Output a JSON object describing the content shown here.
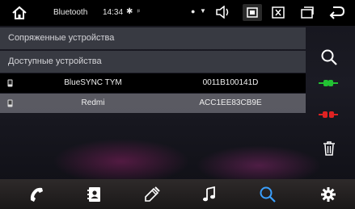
{
  "statusbar": {
    "title": "Bluetooth",
    "time": "14:34"
  },
  "sections": {
    "paired": "Сопряженные устройства",
    "available": "Доступные устройства"
  },
  "devices": [
    {
      "name": "BlueSYNC TYM",
      "address": "0011B100141D",
      "selected": false
    },
    {
      "name": "Redmi",
      "address": "ACC1EE83CB9E",
      "selected": true
    }
  ],
  "colors": {
    "connect": "#22c233",
    "disconnect": "#e02222",
    "search_active": "#3aa0ff",
    "selected_row": "#5f6068"
  },
  "icons": {
    "home": "home-icon",
    "volume": "volume-icon",
    "screenshot": "screenshot-icon",
    "close": "close-icon",
    "window": "window-icon",
    "back": "back-icon",
    "search": "search-icon",
    "connect": "connect-icon",
    "disconnect": "disconnect-icon",
    "delete": "trash-icon",
    "phone": "phone-icon",
    "contacts": "contacts-icon",
    "dialpad": "dialpad-icon",
    "music": "music-icon",
    "settings": "gear-icon"
  }
}
